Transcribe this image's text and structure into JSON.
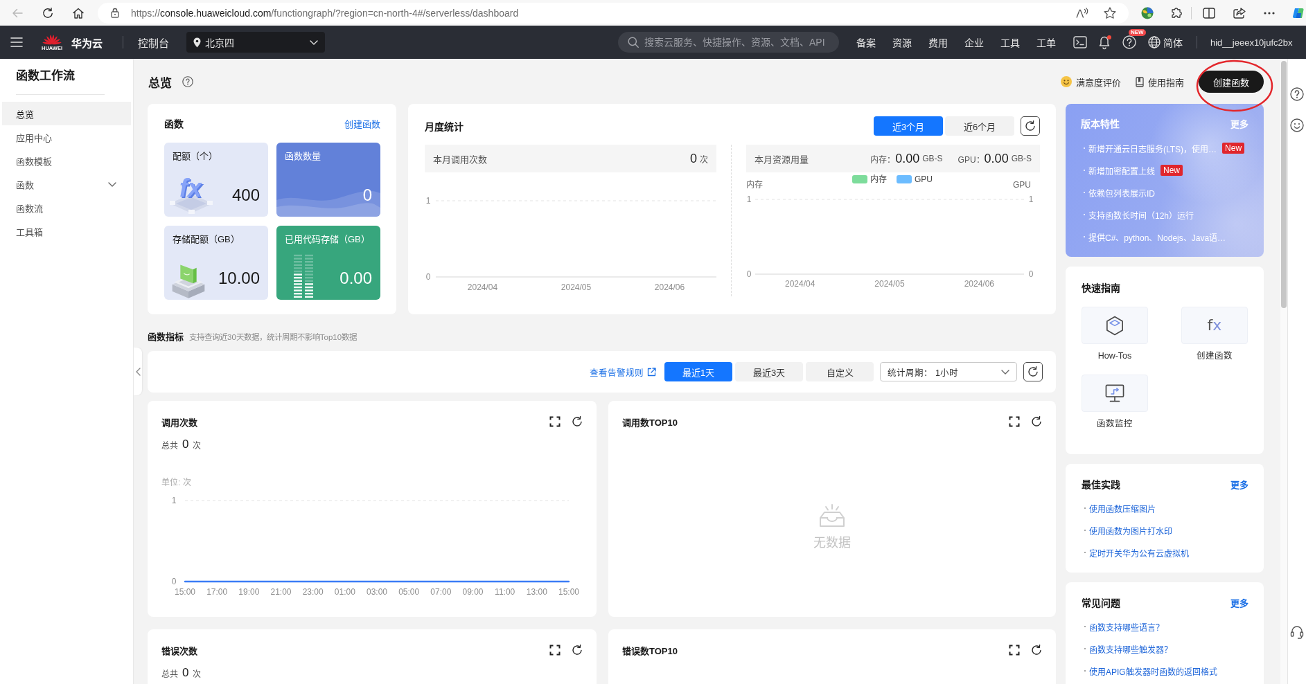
{
  "browser": {
    "url": {
      "scheme": "https://",
      "host": "console.huaweicloud.com",
      "path": "/functiongraph/?region=cn-north-4#/serverless/dashboard"
    }
  },
  "topnav": {
    "logo_text": "HUAWEI",
    "brand": "华为云",
    "console": "控制台",
    "region": "北京四",
    "search": {
      "placeholder": "搜索云服务、快捷操作、资源、文档、API"
    },
    "links": [
      "备案",
      "资源",
      "费用",
      "企业",
      "工具",
      "工单"
    ],
    "unread": true,
    "help_badge": "NEW",
    "language": "简体",
    "user": "hid__jeeex10jufc2bx"
  },
  "sidebar": {
    "title": "函数工作流",
    "items": [
      {
        "label": "总览",
        "selected": true
      },
      {
        "label": "应用中心",
        "selected": false
      },
      {
        "label": "函数模板",
        "selected": false
      },
      {
        "label": "函数",
        "selected": false,
        "expanded": false
      },
      {
        "label": "函数流",
        "selected": false
      },
      {
        "label": "工具箱",
        "selected": false
      }
    ]
  },
  "header": {
    "title": "总览",
    "actions": [
      {
        "kind": "feedback",
        "label": "满意度评价"
      },
      {
        "kind": "guide",
        "label": "使用指南"
      },
      {
        "kind": "primary",
        "label": "创建函数"
      }
    ]
  },
  "functions": {
    "title": "函数",
    "link": "创建函数",
    "tiles": [
      {
        "kind": "quota",
        "label": "配额（个）",
        "value": "400",
        "glyph": "fx"
      },
      {
        "kind": "count",
        "label": "函数数量",
        "value": "0"
      },
      {
        "kind": "storage",
        "label": "存储配额（GB）",
        "value": "10.00"
      },
      {
        "kind": "used",
        "label": "已用代码存储（GB）",
        "value": "0.00"
      }
    ]
  },
  "monthly": {
    "title": "月度统计",
    "ranges": [
      {
        "label": "近3个月",
        "selected": true
      },
      {
        "label": "近6个月",
        "selected": false
      }
    ],
    "invocations": {
      "label": "本月调用次数",
      "value": "0",
      "unit": "次",
      "chart_data": {
        "type": "bar",
        "categories": [
          "2024/04",
          "2024/05",
          "2024/06"
        ],
        "ylim": [
          0,
          1
        ],
        "yticks": [
          0,
          1
        ],
        "values": [
          0,
          0,
          0
        ]
      }
    },
    "resources": {
      "label": "本月资源用量",
      "readings": [
        {
          "label": "内存：",
          "value": "0.00",
          "unit": "GB-S"
        },
        {
          "label": "GPU：",
          "value": "0.00",
          "unit": "GB-S"
        }
      ],
      "right_axis": {
        "label": "GPU",
        "ticks": [
          "1",
          "0"
        ]
      },
      "chart_data": {
        "type": "bar",
        "ylabel": "内存",
        "categories": [
          "2024/04",
          "2024/05",
          "2024/06"
        ],
        "ylim": [
          0,
          1
        ],
        "yticks": [
          0,
          1
        ],
        "series": [
          {
            "name": "内存",
            "color": "#7ddc9b",
            "values": [
              0,
              0,
              0
            ]
          },
          {
            "name": "GPU",
            "color": "#6cbcff",
            "values": [
              0,
              0,
              0
            ]
          }
        ]
      }
    }
  },
  "metrics": {
    "title": "函数指标",
    "hint": "支持查询近30天数据，统计周期不影响Top10数据",
    "alert_link": "查看告警规则",
    "ranges": [
      {
        "label": "最近1天",
        "selected": true
      },
      {
        "label": "最近3天",
        "selected": false
      },
      {
        "label": "自定义",
        "selected": false
      }
    ],
    "period": {
      "label": "统计周期：",
      "value": "1小时"
    },
    "panels": [
      {
        "title": "调用次数",
        "total_label": "总共",
        "total": "0",
        "unit": "次",
        "chart_data": {
          "type": "line",
          "ylabel": "单位: 次",
          "categories": [
            "15:00",
            "17:00",
            "19:00",
            "21:00",
            "23:00",
            "01:00",
            "03:00",
            "05:00",
            "07:00",
            "09:00",
            "11:00",
            "13:00",
            "15:00"
          ],
          "ylim": [
            0,
            1
          ],
          "yticks": [
            0,
            1
          ],
          "values": [
            0,
            0,
            0,
            0,
            0,
            0,
            0,
            0,
            0,
            0,
            0,
            0,
            0
          ]
        }
      },
      {
        "title": "调用数TOP10",
        "empty_text": "无数据"
      },
      {
        "title": "错误次数",
        "total_label": "总共",
        "total": "0",
        "unit": "次"
      },
      {
        "title": "错误数TOP10"
      }
    ]
  },
  "features": {
    "title": "版本特性",
    "more": "更多",
    "items": [
      {
        "text": "新增开通云日志服务(LTS)，使用…",
        "badge": "New"
      },
      {
        "text": "新增加密配置上线",
        "badge": "New"
      },
      {
        "text": "依赖包列表展示ID"
      },
      {
        "text": "支持函数长时间（12h）运行"
      },
      {
        "text": "提供C#、python、Nodejs、Java语…"
      }
    ]
  },
  "quick_guide": {
    "title": "快速指南",
    "items": [
      {
        "kind": "howto",
        "label": "How-Tos"
      },
      {
        "kind": "create",
        "label": "创建函数",
        "glyph": "fx"
      },
      {
        "kind": "monitor",
        "label": "函数监控"
      }
    ]
  },
  "best_practices": {
    "title": "最佳实践",
    "more": "更多",
    "links": [
      "使用函数压缩图片",
      "使用函数为图片打水印",
      "定时开关华为公有云虚拟机"
    ]
  },
  "faq": {
    "title": "常见问题",
    "more": "更多",
    "links": [
      "函数支持哪些语言？",
      "函数支持哪些触发器？",
      "使用APIG触发器时函数的返回格式"
    ]
  }
}
